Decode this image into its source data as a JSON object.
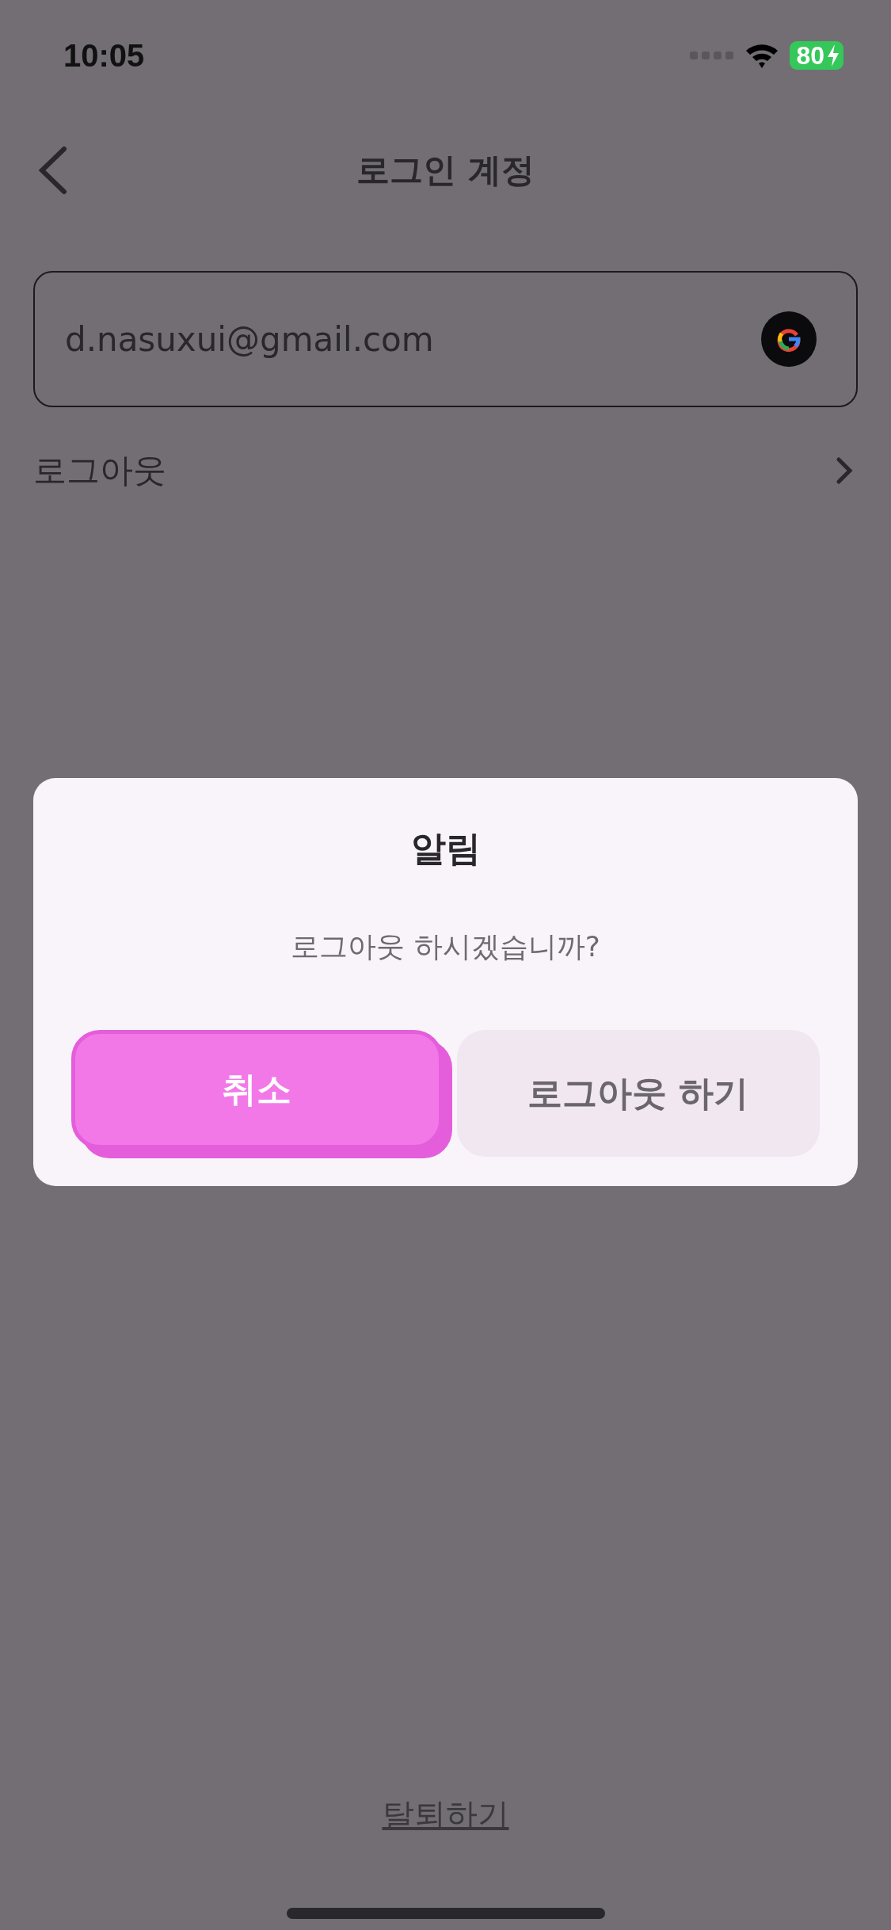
{
  "status_bar": {
    "time": "10:05",
    "battery": "80"
  },
  "header": {
    "title": "로그인 계정"
  },
  "account": {
    "email": "d.nasuxui@gmail.com"
  },
  "menu": [
    {
      "label": "로그아웃"
    }
  ],
  "footer": {
    "link": "탈퇴하기"
  },
  "dialog": {
    "title": "알림",
    "message": "로그아웃 하시겠습니까?",
    "buttons": [
      {
        "label": "취소",
        "kind": "primary"
      },
      {
        "label": "로그아웃 하기",
        "kind": "secondary"
      }
    ]
  }
}
